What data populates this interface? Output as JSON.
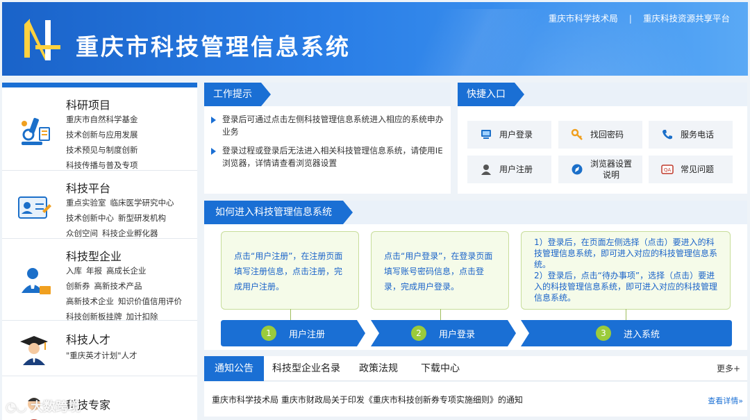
{
  "header": {
    "title": "重庆市科技管理信息系统",
    "links": [
      "重庆市科学技术局",
      "重庆科技资源共享平台"
    ],
    "separator": "|"
  },
  "sidebar": {
    "categories": [
      {
        "title": "科研项目",
        "icon": "microscope-icon",
        "lines": [
          [
            "重庆市自然科学基金"
          ],
          [
            "技术创新与应用发展"
          ],
          [
            "技术预见与制度创新"
          ],
          [
            "科技传播与普及专项"
          ]
        ]
      },
      {
        "title": "科技平台",
        "icon": "id-card-icon",
        "lines": [
          [
            "重点实验室",
            "临床医学研究中心"
          ],
          [
            "技术创新中心",
            "新型研发机构"
          ],
          [
            "众创空间",
            "科技企业孵化器"
          ]
        ]
      },
      {
        "title": "科技型企业",
        "icon": "enterprise-user-icon",
        "lines": [
          [
            "入库",
            "年报",
            "高成长企业"
          ],
          [
            "创新券",
            "高新技术产品"
          ],
          [
            "高新技术企业",
            "知识价值信用评价"
          ],
          [
            "科技创新板挂牌",
            "加计扣除"
          ]
        ]
      },
      {
        "title": "科技人才",
        "icon": "graduate-icon",
        "lines": [
          [
            "\"重庆英才计划\"人才"
          ]
        ]
      },
      {
        "title": "科技专家",
        "icon": "expert-icon",
        "lines": []
      }
    ]
  },
  "work_tips": {
    "title": "工作提示",
    "items": [
      "登录后可通过点击左侧科技管理信息系统进入相应的系统申办业务",
      "登录过程或登录后无法进入相关科技管理信息系统，请使用IE浏览器，详情请查看浏览器设置"
    ]
  },
  "quick": {
    "title": "快捷入口",
    "buttons": [
      {
        "label": "用户登录",
        "icon": "monitor-icon"
      },
      {
        "label": "找回密码",
        "icon": "key-icon"
      },
      {
        "label": "服务电话",
        "icon": "phone-icon"
      },
      {
        "label": "用户注册",
        "icon": "user-icon"
      },
      {
        "label": "浏览器设置说明",
        "label_line1": "浏览器设置",
        "label_line2": "说明",
        "icon": "browser-icon"
      },
      {
        "label": "常见问题",
        "icon": "qa-icon"
      }
    ]
  },
  "guide": {
    "title": "如何进入科技管理信息系统",
    "cards": [
      "点击“用户注册”，在注册页面填写注册信息，点击注册，完成用户注册。",
      "点击“用户登录”，在登录页面填写账号密码信息，点击登录，完成用户登录。",
      "1）登录后，在页面左侧选择（点击）要进入的科技管理信息系统，即可进入对应的科技管理信息系统。",
      "2）登录后，点击“待办事项”，选择（点击）要进入的科技管理信息系统，即可进入对应的科技管理信息系统。"
    ],
    "steps": [
      {
        "num": "1",
        "label": "用户注册"
      },
      {
        "num": "2",
        "label": "用户登录"
      },
      {
        "num": "3",
        "label": "进入系统"
      }
    ]
  },
  "notice": {
    "tabs": [
      "通知公告",
      "科技型企业名录",
      "政策法规",
      "下载中心"
    ],
    "more": "更多+",
    "item": "重庆市科学技术局 重庆市财政局关于印发《重庆市科技创新券专项实施细则》的通知",
    "detail": "查看详情»"
  },
  "watermark": "大数跨境",
  "colors": {
    "primary": "#1a6fd4",
    "step_green": "#9bcb3b",
    "card_bg": "#f5fbe9"
  }
}
